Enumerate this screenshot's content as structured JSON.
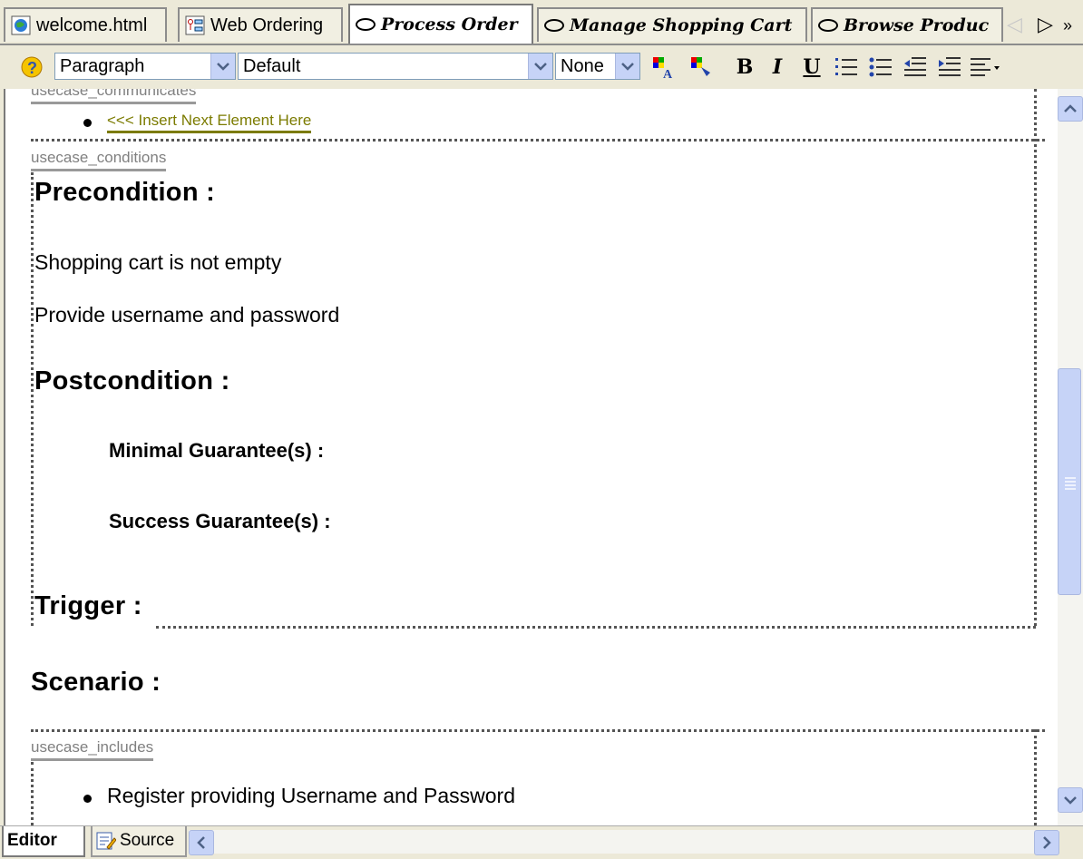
{
  "tabs": [
    {
      "label": "welcome.html",
      "icon": "html-file-icon",
      "active": false
    },
    {
      "label": "Web Ordering",
      "icon": "diagram-icon",
      "active": false
    },
    {
      "label": "Process Order",
      "icon": "usecase-icon",
      "active": true
    },
    {
      "label": "Manage Shopping Cart",
      "icon": "usecase-icon",
      "active": false
    },
    {
      "label": "Browse Produc",
      "icon": "usecase-icon",
      "active": false
    }
  ],
  "toolbar": {
    "paragraph_style": "Paragraph",
    "font_name": "Default",
    "font_size": "None",
    "bold_label": "B",
    "italic_label": "I",
    "underline_label": "U"
  },
  "document": {
    "communicates_tag": "usecase_communicates",
    "insert_placeholder": "<<< Insert Next Element Here",
    "conditions_tag": "usecase_conditions",
    "precondition_heading": "Precondition :",
    "preconditions": [
      "Shopping cart is not empty",
      "Provide username and password"
    ],
    "postcondition_heading": "Postcondition :",
    "minimal_guarantee": "Minimal Guarantee(s) :",
    "success_guarantee": "Success Guarantee(s) :",
    "trigger_heading": "Trigger :",
    "scenario_heading": "Scenario :",
    "includes_tag": "usecase_includes",
    "includes_items": [
      "Register providing Username and Password"
    ]
  },
  "bottom_tabs": [
    {
      "label": "Editor",
      "active": true
    },
    {
      "label": "Source",
      "active": false
    }
  ]
}
